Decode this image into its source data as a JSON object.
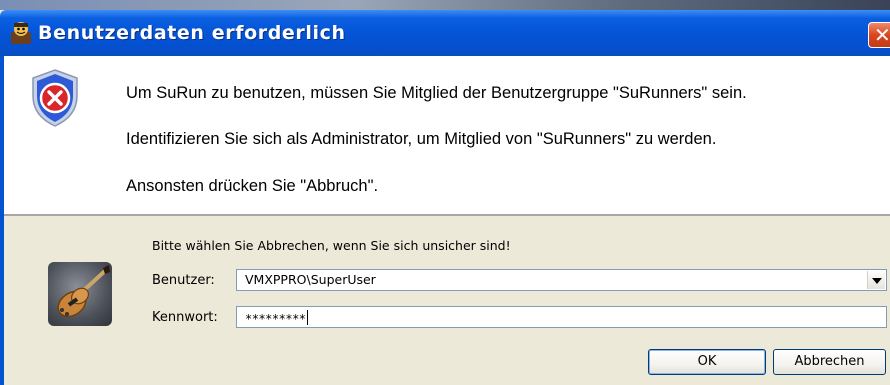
{
  "window": {
    "title": "Benutzerdaten erforderlich",
    "close_glyph": "✕",
    "app_icon": "surun-app-icon",
    "titlebar_color": "#0556d8"
  },
  "message": {
    "icon": "security-shield-error-icon",
    "lines": [
      "Um SuRun zu benutzen, müssen Sie Mitglied der Benutzergruppe \"SuRunners\" sein.",
      "Identifizieren Sie sich als Administrator, um Mitglied von \"SuRunners\" zu werden.",
      "Ansonsten drücken Sie \"Abbruch\"."
    ]
  },
  "credentials": {
    "hint": "Bitte wählen Sie Abbrechen, wenn Sie sich unsicher sind!",
    "avatar": "guitar-user-avatar",
    "user_label": "Benutzer:",
    "user_value": "VMXPPRO\\SuperUser",
    "password_label": "Kennwort:",
    "password_value": "*********"
  },
  "buttons": {
    "ok": "OK",
    "cancel": "Abbrechen"
  }
}
